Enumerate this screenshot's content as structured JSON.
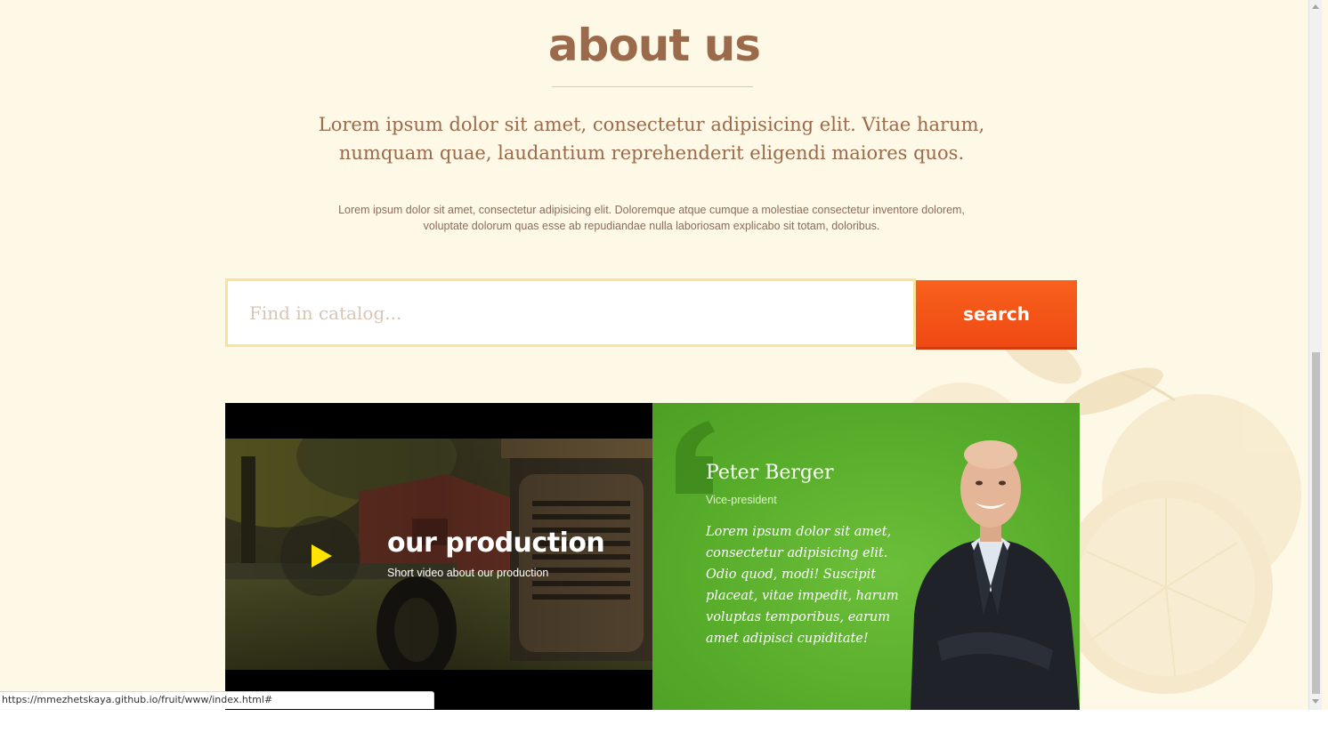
{
  "about": {
    "title": "about us",
    "lead": "Lorem ipsum dolor sit amet, consectetur adipisicing elit. Vitae harum, numquam quae, laudantium reprehenderit eligendi maiores quos.",
    "body": "Lorem ipsum dolor sit amet, consectetur adipisicing elit. Doloremque atque cumque a molestiae consectetur inventore dolorem, voluptate dolorum quas esse ab repudiandae nulla laboriosam explicabo sit totam, doloribus."
  },
  "search": {
    "placeholder": "Find in catalog...",
    "value": "",
    "button_label": "search"
  },
  "video": {
    "title": "our production",
    "subtitle": "Short video about our production",
    "play_icon": "play-icon"
  },
  "testimonial": {
    "name": "Peter Berger",
    "role": "Vice-president",
    "quote": "Lorem ipsum dolor sit amet, consectetur adipisicing elit. Odio quod, modi! Suscipit placeat, vitae impedit, harum voluptas temporibus, earum amet adipisci cupiditate!"
  },
  "status_bar": {
    "url": "https://mmezhetskaya.github.io/fruit/www/index.html#"
  },
  "colors": {
    "background": "#fef8e6",
    "heading": "#9b6a4a",
    "search_border": "#f8e39a",
    "search_button": "#f8611c",
    "testimonial_green": "#58ad2b",
    "play_yellow": "#ffe400"
  }
}
